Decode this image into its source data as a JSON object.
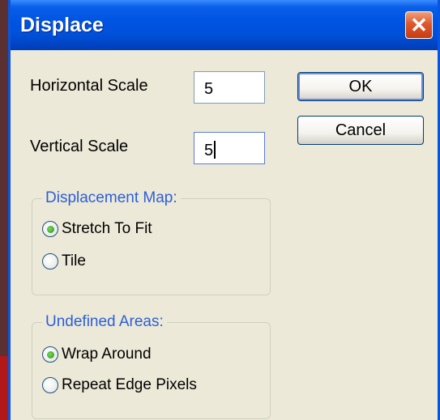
{
  "dialog": {
    "title": "Displace",
    "close_glyph": "✕"
  },
  "fields": {
    "horizontal_scale_label": "Horizontal Scale",
    "horizontal_scale_value": "5",
    "vertical_scale_label": "Vertical Scale",
    "vertical_scale_value": "5"
  },
  "buttons": {
    "ok": "OK",
    "cancel": "Cancel"
  },
  "displacement_map": {
    "legend": "Displacement Map:",
    "options": [
      {
        "label": "Stretch To Fit",
        "selected": true
      },
      {
        "label": "Tile",
        "selected": false
      }
    ]
  },
  "undefined_areas": {
    "legend": "Undefined Areas:",
    "options": [
      {
        "label": "Wrap Around",
        "selected": true
      },
      {
        "label": "Repeat Edge Pixels",
        "selected": false
      }
    ]
  }
}
